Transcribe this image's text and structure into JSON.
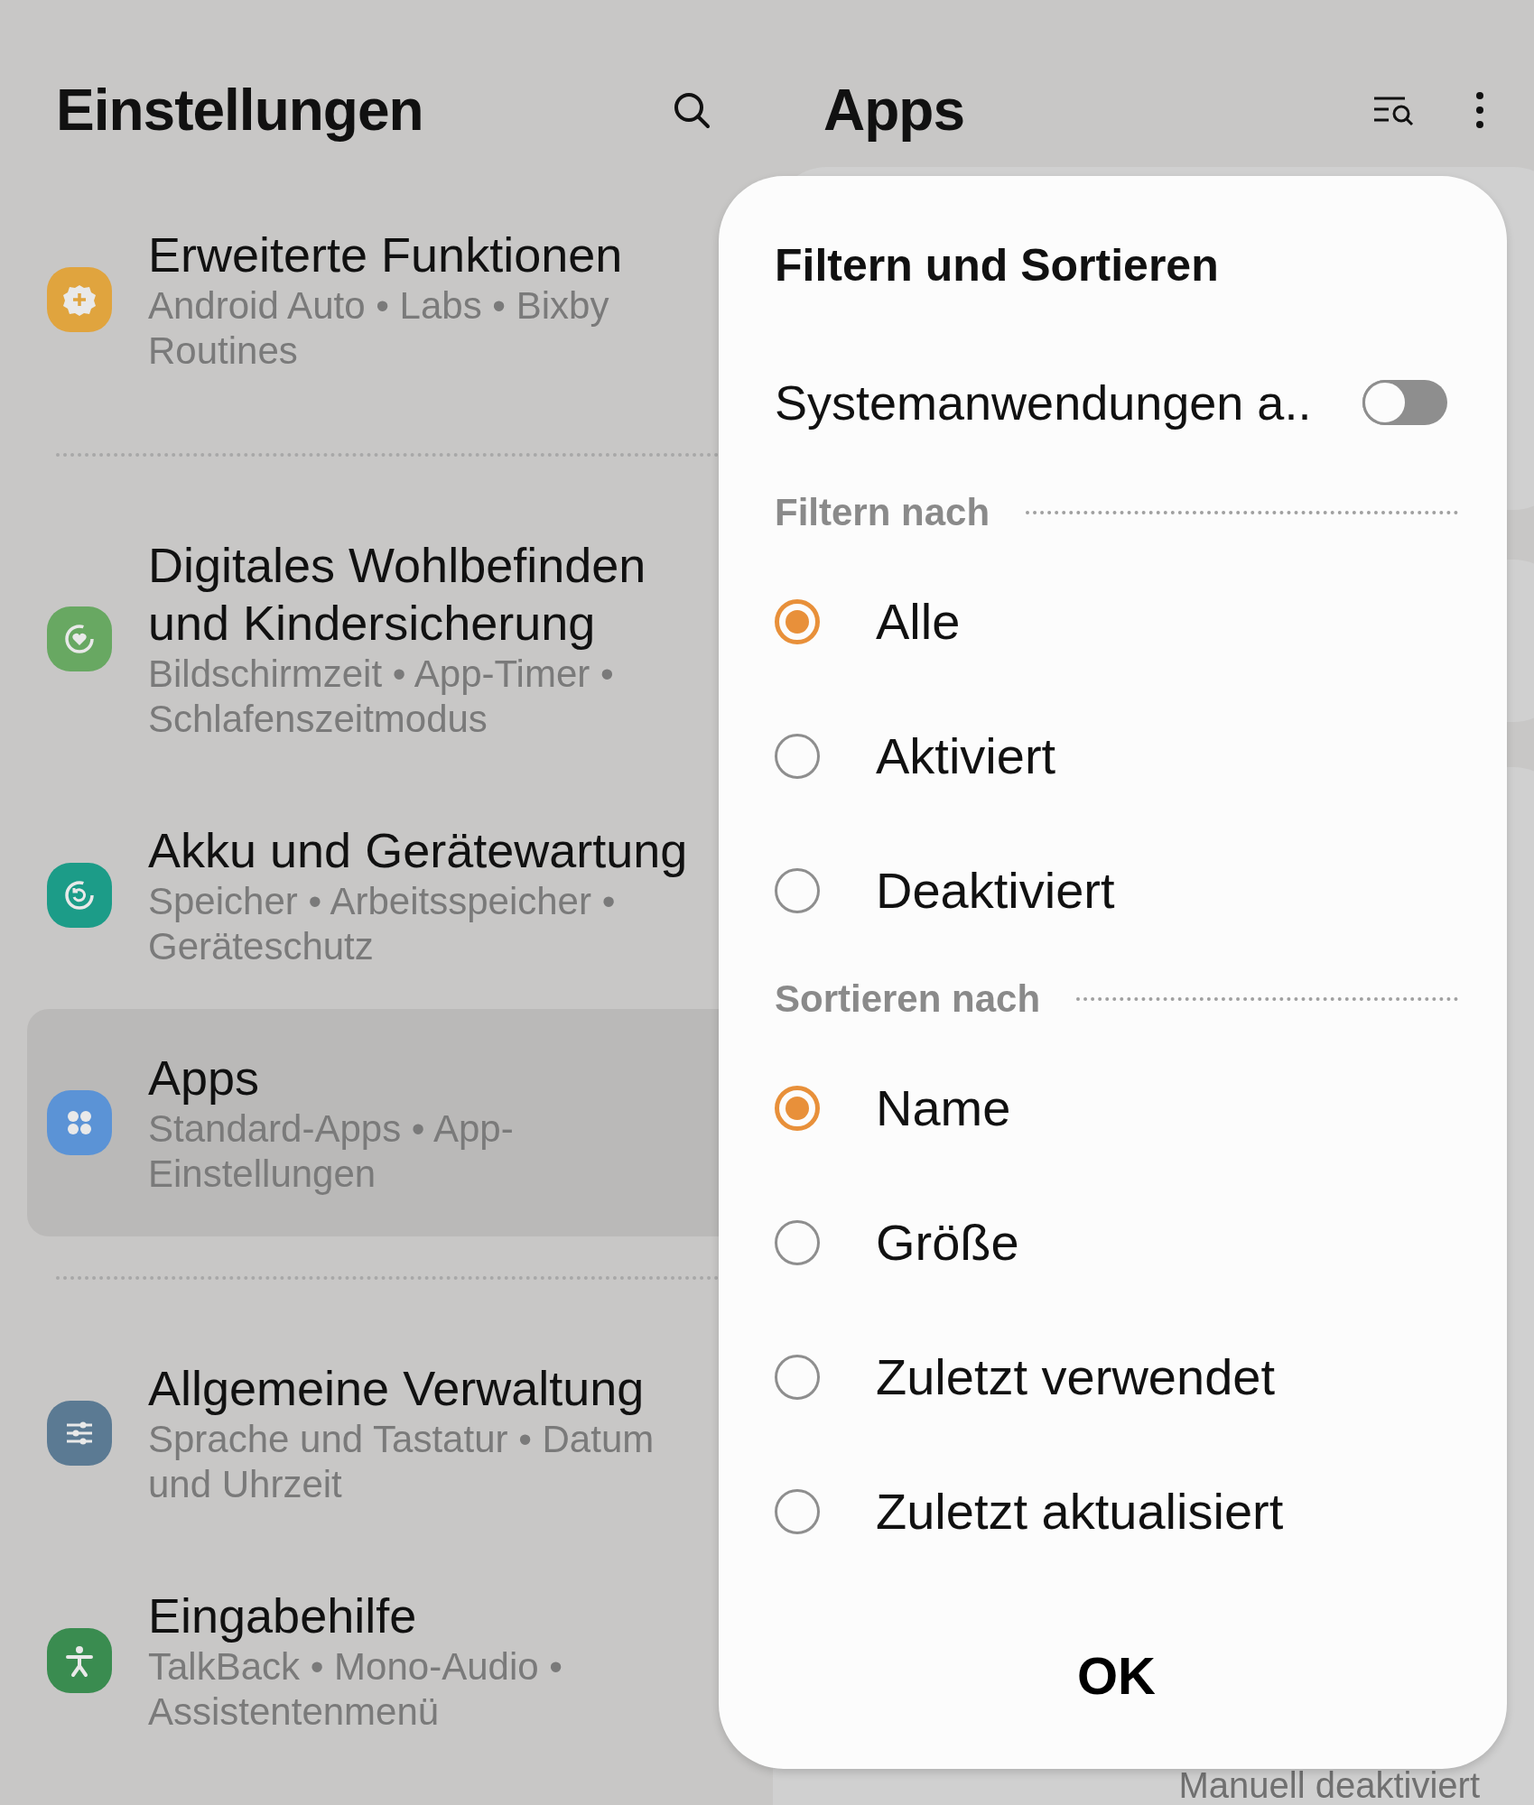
{
  "settings": {
    "title": "Einstellungen",
    "groups": [
      [
        {
          "title": "Erweiterte Funktionen",
          "subtitle": "Android Auto • Labs • Bixby Routines",
          "color": "#e0a43e",
          "selected": false
        }
      ],
      [
        {
          "title": "Digitales Wohlbefinden und Kindersicherung",
          "subtitle": "Bildschirmzeit • App-Timer • Schlafenszeitmodus",
          "color": "#68a862",
          "selected": false
        },
        {
          "title": "Akku und Gerätewartung",
          "subtitle": "Speicher • Arbeitsspeicher • Geräteschutz",
          "color": "#1c9c88",
          "selected": false
        },
        {
          "title": "Apps",
          "subtitle": "Standard-Apps • App-Einstellungen",
          "color": "#5b93d6",
          "selected": true
        }
      ],
      [
        {
          "title": "Allgemeine Verwaltung",
          "subtitle": "Sprache und Tastatur • Datum und Uhrzeit",
          "color": "#5b7a93",
          "selected": false
        },
        {
          "title": "Eingabehilfe",
          "subtitle": "TalkBack • Mono-Audio • Assistentenmenü",
          "color": "#3a8c50",
          "selected": false
        }
      ]
    ]
  },
  "apps": {
    "title": "Apps",
    "background_text": "Manuell deaktiviert"
  },
  "dialog": {
    "title": "Filtern und Sortieren",
    "toggle": {
      "label": "Systemanwendungen a..",
      "on": false
    },
    "sections": [
      {
        "heading": "Filtern nach",
        "options": [
          {
            "label": "Alle",
            "selected": true
          },
          {
            "label": "Aktiviert",
            "selected": false
          },
          {
            "label": "Deaktiviert",
            "selected": false
          }
        ]
      },
      {
        "heading": "Sortieren nach",
        "options": [
          {
            "label": "Name",
            "selected": true
          },
          {
            "label": "Größe",
            "selected": false
          },
          {
            "label": "Zuletzt verwendet",
            "selected": false
          },
          {
            "label": "Zuletzt aktualisiert",
            "selected": false
          }
        ]
      }
    ],
    "button": "OK"
  }
}
